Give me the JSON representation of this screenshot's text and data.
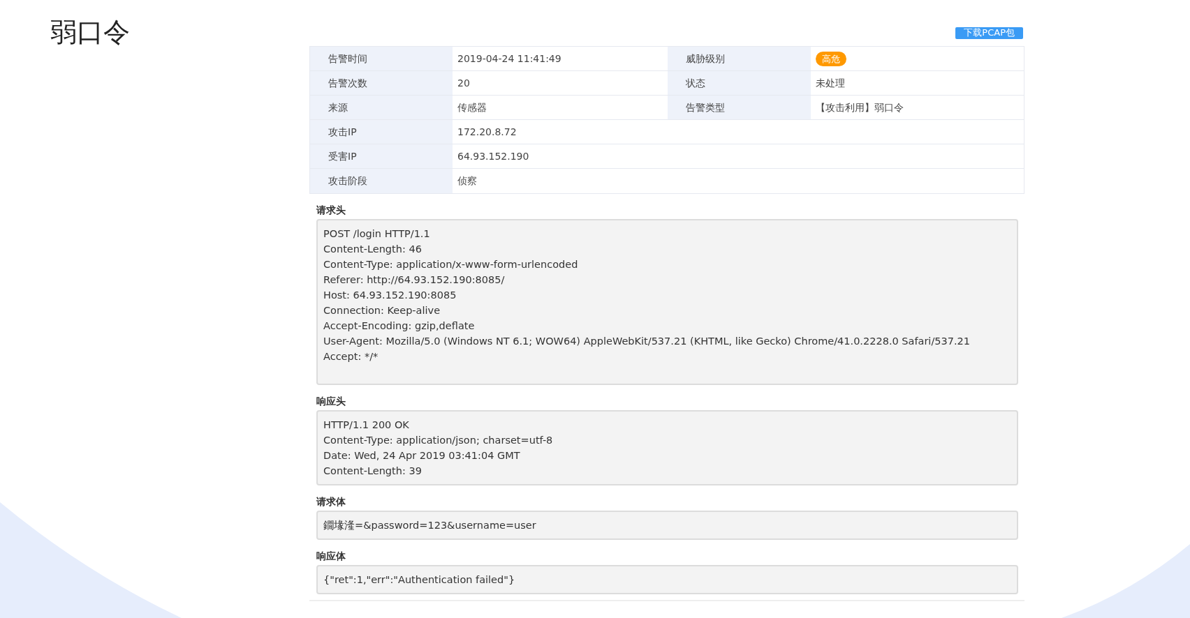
{
  "slide_title": "弱口令",
  "download_button": "下载PCAP包",
  "info_rows": [
    {
      "label": "告警时间",
      "value": "2019-04-24 11:41:49",
      "label_2": "威胁级别",
      "value_2": "高危",
      "kind": "badge",
      "color": "#ff9900"
    },
    {
      "label": "告警次数",
      "value": "20",
      "label_2": "状态",
      "value_2": "未处理",
      "kind": "text"
    },
    {
      "label": "来源",
      "value": "传感器",
      "label_2": "告警类型",
      "value_2": "【攻击利用】弱口令",
      "kind": "text"
    },
    {
      "label": "攻击IP",
      "value": "172.20.8.72"
    },
    {
      "label": "受害IP",
      "value": "64.93.152.190"
    },
    {
      "label": "攻击阶段",
      "value": "侦察"
    }
  ],
  "sections": [
    {
      "heading": "请求头",
      "lines": [
        "POST /login HTTP/1.1",
        "Content-Length: 46",
        "Content-Type: application/x-www-form-urlencoded",
        "Referer: http://64.93.152.190:8085/",
        "Host: 64.93.152.190:8085",
        "Connection: Keep-alive",
        "Accept-Encoding: gzip,deflate",
        "User-Agent: Mozilla/5.0 (Windows NT 6.1; WOW64) AppleWebKit/537.21 (KHTML, like Gecko) Chrome/41.0.2228.0 Safari/537.21",
        "Accept: */*"
      ],
      "extra_space": true
    },
    {
      "heading": "响应头",
      "lines": [
        "HTTP/1.1 200 OK",
        "Content-Type: application/json; charset=utf-8",
        "Date: Wed, 24 Apr 2019 03:41:04 GMT",
        "Content-Length: 39"
      ],
      "extra_space": false
    },
    {
      "heading": "请求体",
      "lines": [
        "鐗堟湰=&password=123&username=user"
      ],
      "extra_space": false
    },
    {
      "heading": "响应体",
      "lines": [
        "{\"ret\":1,\"err\":\"Authentication failed\"}"
      ],
      "extra_space": false
    }
  ]
}
